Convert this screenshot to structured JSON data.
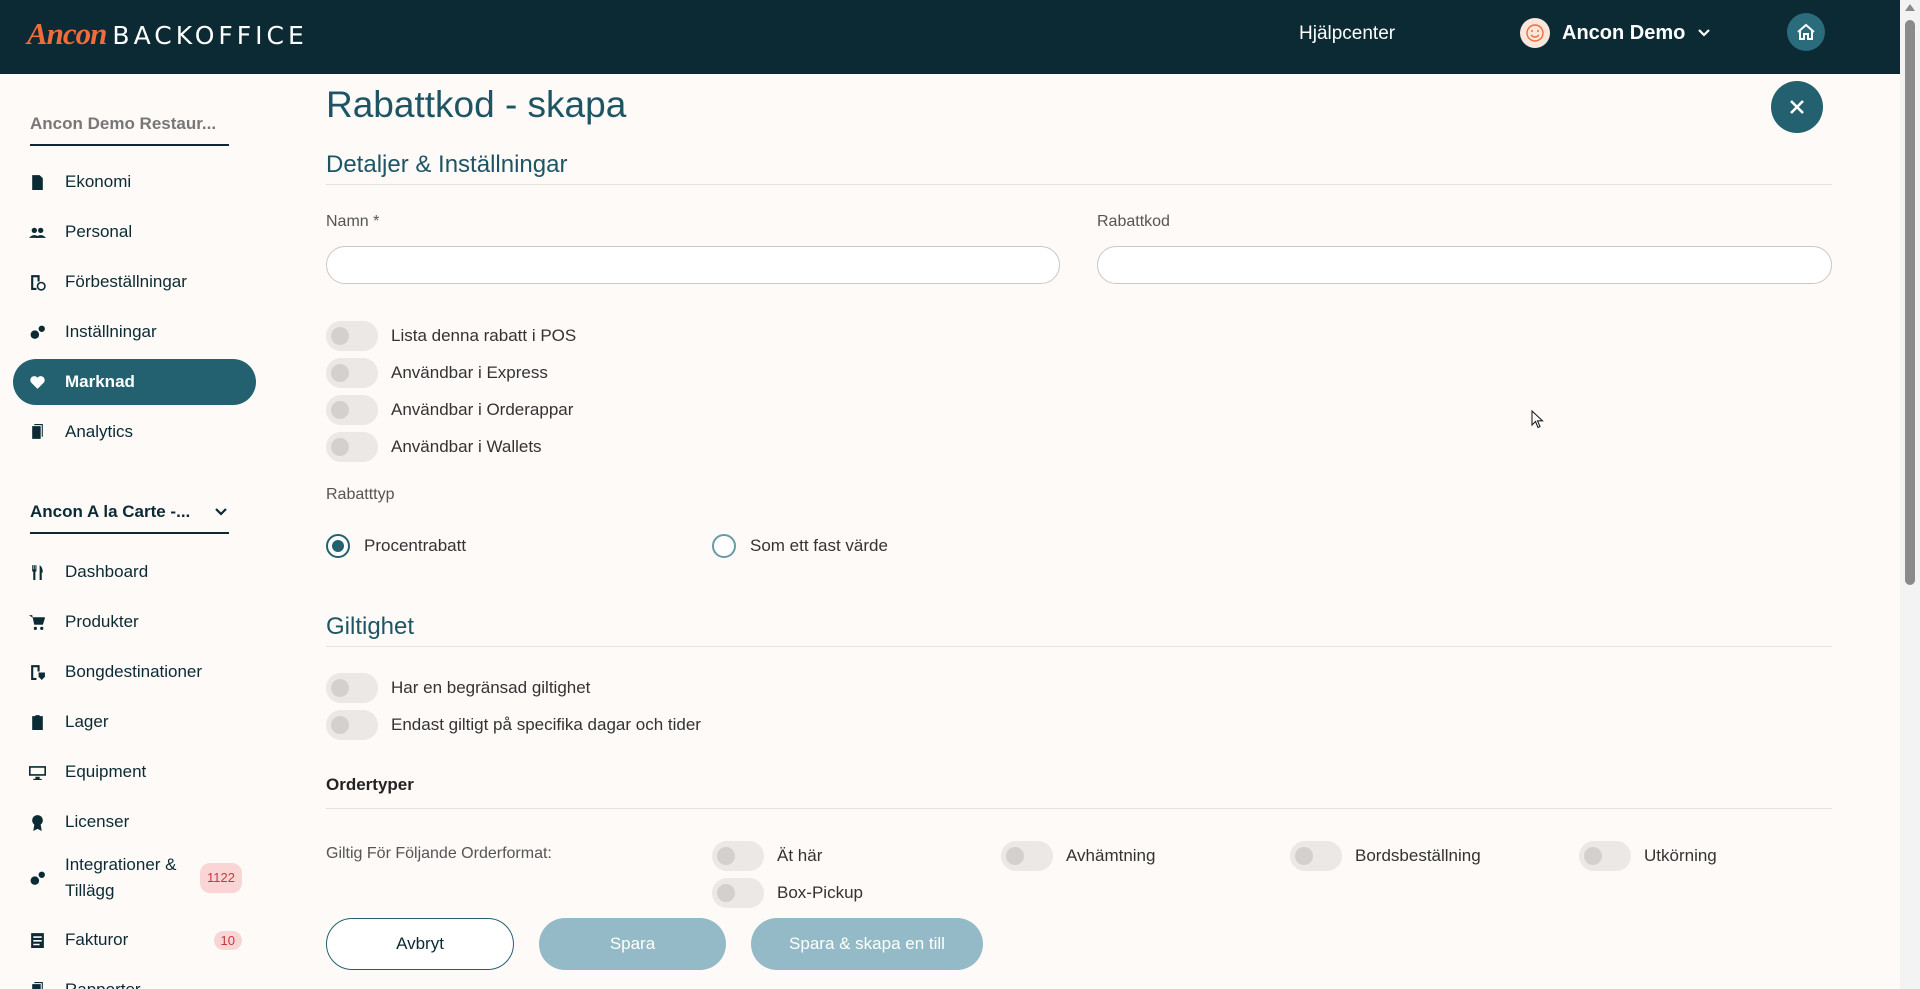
{
  "header": {
    "logo_brand": "Ancon",
    "logo_product": "BACKOFFICE",
    "help_link": "Hjälpcenter",
    "user_name": "Ancon Demo"
  },
  "sidebar": {
    "org_name": "Ancon Demo Restaur...",
    "org_items": [
      {
        "label": "Ekonomi",
        "icon": "receipt-icon"
      },
      {
        "label": "Personal",
        "icon": "people-icon"
      },
      {
        "label": "Förbeställningar",
        "icon": "preorder-icon"
      },
      {
        "label": "Inställningar",
        "icon": "gears-icon"
      },
      {
        "label": "Marknad",
        "icon": "heart-icon",
        "active": true
      },
      {
        "label": "Analytics",
        "icon": "report-icon"
      }
    ],
    "store_name": "Ancon A la Carte -...",
    "store_items": [
      {
        "label": "Dashboard",
        "icon": "cutlery-icon"
      },
      {
        "label": "Produkter",
        "icon": "cart-icon"
      },
      {
        "label": "Bongdestinationer",
        "icon": "ticket-icon"
      },
      {
        "label": "Lager",
        "icon": "clipboard-icon"
      },
      {
        "label": "Equipment",
        "icon": "monitor-icon"
      },
      {
        "label": "Licenser",
        "icon": "award-icon"
      },
      {
        "label": "Integrationer & Tillägg",
        "icon": "gears-icon",
        "badge": "1122"
      },
      {
        "label": "Fakturor",
        "icon": "invoice-icon",
        "badge": "10"
      },
      {
        "label": "Rapporter",
        "icon": "report-icon"
      }
    ]
  },
  "form": {
    "title": "Rabattkod - skapa",
    "details_section": "Detaljer & Inställningar",
    "name_label": "Namn *",
    "name_value": "",
    "code_label": "Rabattkod",
    "code_value": "",
    "toggles": [
      {
        "label": "Lista denna rabatt i POS",
        "on": false
      },
      {
        "label": "Användbar i Express",
        "on": false
      },
      {
        "label": "Användbar i Orderappar",
        "on": false
      },
      {
        "label": "Användbar i Wallets",
        "on": false
      }
    ],
    "discount_type_label": "Rabatttyp",
    "discount_types": [
      {
        "label": "Procentrabatt",
        "checked": true
      },
      {
        "label": "Som ett fast värde",
        "checked": false
      }
    ],
    "validity_section": "Giltighet",
    "validity_toggles": [
      {
        "label": "Har en begränsad giltighet",
        "on": false
      },
      {
        "label": "Endast giltigt på specifika dagar och tider",
        "on": false
      }
    ],
    "order_types_heading": "Ordertyper",
    "order_formats_label": "Giltig För Följande Orderformat:",
    "order_formats": [
      {
        "label": "Ät här",
        "on": false
      },
      {
        "label": "Avhämtning",
        "on": false
      },
      {
        "label": "Bordsbeställning",
        "on": false
      },
      {
        "label": "Utkörning",
        "on": false
      },
      {
        "label": "Box-Pickup",
        "on": false
      }
    ]
  },
  "footer": {
    "cancel_label": "Avbryt",
    "save_label": "Spara",
    "save_new_label": "Spara & skapa en till"
  }
}
